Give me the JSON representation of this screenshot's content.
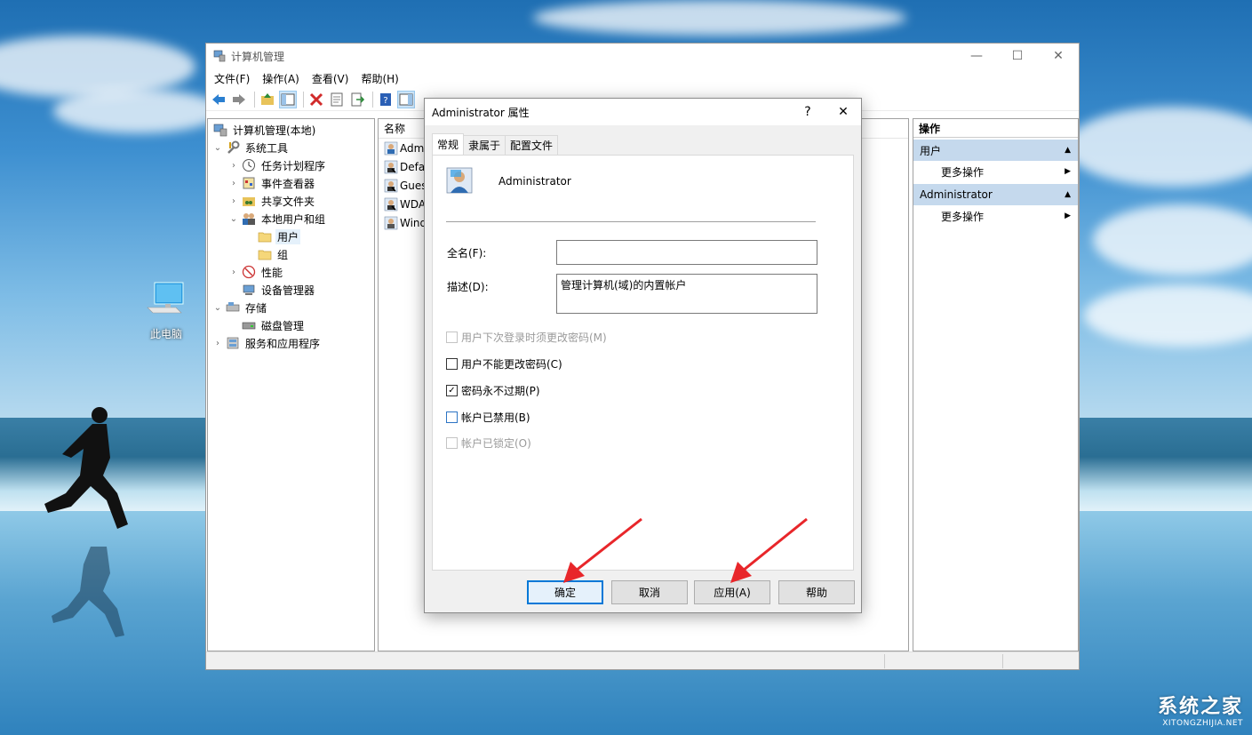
{
  "window": {
    "title": "计算机管理",
    "menus": [
      "文件(F)",
      "操作(A)",
      "查看(V)",
      "帮助(H)"
    ]
  },
  "tree": {
    "root": "计算机管理(本地)",
    "system_tools": "系统工具",
    "task_scheduler": "任务计划程序",
    "event_viewer": "事件查看器",
    "shared_folders": "共享文件夹",
    "local_users": "本地用户和组",
    "users": "用户",
    "groups": "组",
    "performance": "性能",
    "device_manager": "设备管理器",
    "storage": "存储",
    "disk_management": "磁盘管理",
    "services": "服务和应用程序"
  },
  "list": {
    "header": "名称",
    "rows": [
      "Admi",
      "Defau",
      "Gues",
      "WDA",
      "Wind"
    ]
  },
  "actions": {
    "header": "操作",
    "section1": "用户",
    "section1_item": "更多操作",
    "section2": "Administrator",
    "section2_item": "更多操作"
  },
  "dialog": {
    "title": "Administrator 属性",
    "help": "?",
    "tabs": [
      "常规",
      "隶属于",
      "配置文件"
    ],
    "username": "Administrator",
    "fullname_label": "全名(F):",
    "fullname_value": "",
    "desc_label": "描述(D):",
    "desc_value": "管理计算机(域)的内置帐户",
    "chk_must_change": "用户下次登录时须更改密码(M)",
    "chk_cannot_change": "用户不能更改密码(C)",
    "chk_never_expires": "密码永不过期(P)",
    "chk_disabled": "帐户已禁用(B)",
    "chk_locked": "帐户已锁定(O)",
    "ok": "确定",
    "cancel": "取消",
    "apply": "应用(A)",
    "help_btn": "帮助"
  },
  "desktop": {
    "icon_label": "此电脑"
  },
  "watermark": {
    "title": "系统之家",
    "sub": "XITONGZHIJIA.NET"
  },
  "colors": {
    "accent": "#0078d7",
    "action_section": "#c5d9ed",
    "arrow": "#e8262a"
  }
}
